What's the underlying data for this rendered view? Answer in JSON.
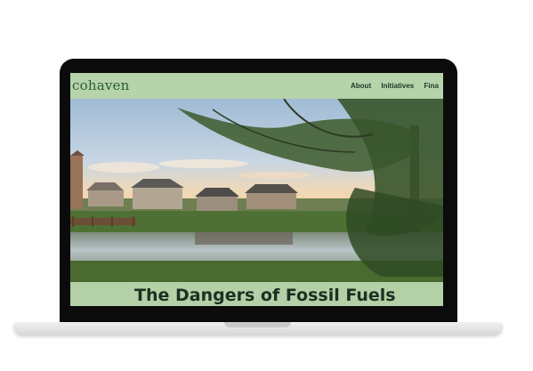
{
  "site": {
    "logo": "cohaven",
    "nav": {
      "items": [
        "About",
        "Initiatives",
        "Fina"
      ]
    },
    "hero": {
      "image": "pond-with-houses-and-tree"
    },
    "title": "The Dangers of Fossil Fuels"
  },
  "colors": {
    "header_green": "#b6d3aa",
    "logo_green": "#2c5a3a",
    "nav_text": "#1d3a27",
    "title_text": "#1e2f22",
    "bezel": "#0b0b0b"
  }
}
